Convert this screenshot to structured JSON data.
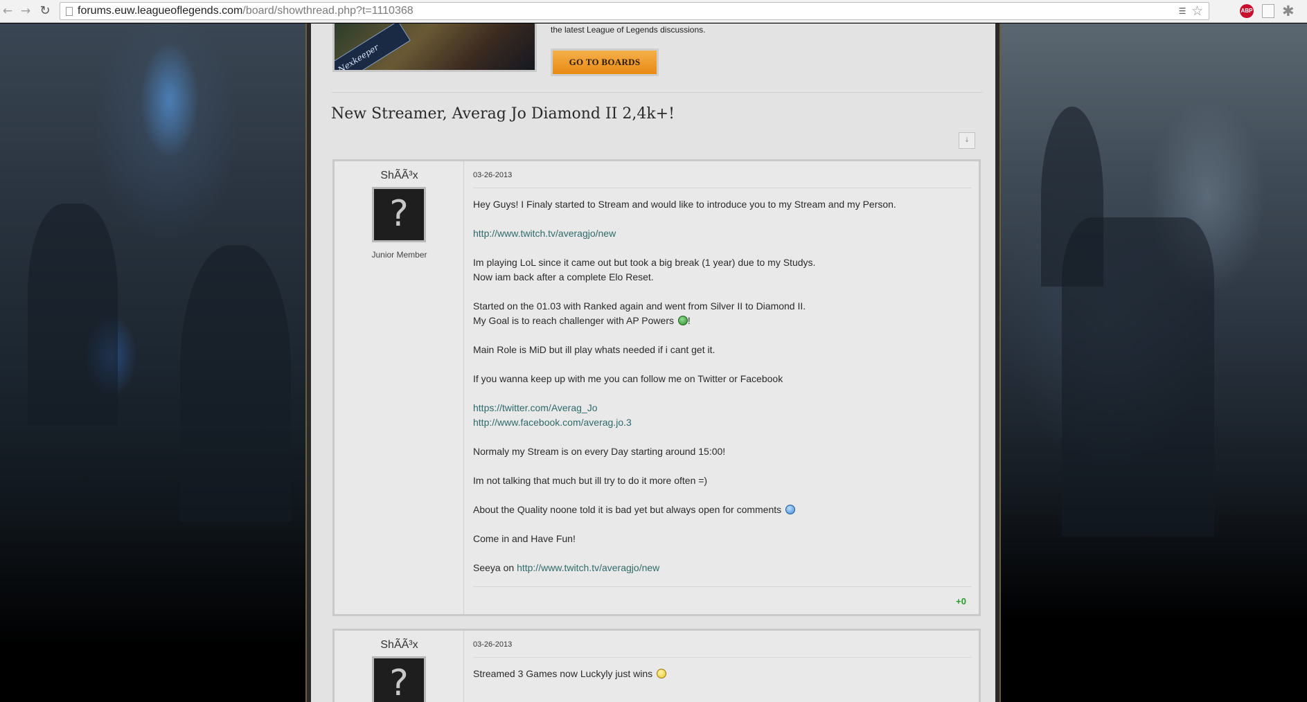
{
  "browser": {
    "url_domain": "forums.euw.leagueoflegends.com",
    "url_path": "/board/showthread.php?t=1110368",
    "extension_abp": "ABP",
    "icons": [
      "back-icon",
      "forward-icon",
      "reload-icon",
      "page-icon",
      "translate-icon",
      "star-icon",
      "adblock-icon",
      "extension-icon",
      "puzzle-icon"
    ]
  },
  "banner": {
    "image_text": "Nexkeeper",
    "text": "the latest League of Legends discussions.",
    "button_label": "GO TO BOARDS"
  },
  "thread": {
    "title": "New Streamer, Averag Jo Diamond II 2,4k+!",
    "tools_label": "↓"
  },
  "posts": [
    {
      "author": "ShÃÃ³x",
      "avatar": "?",
      "rank": "Junior Member",
      "date": "03-26-2013",
      "lines": {
        "l1": "Hey Guys! I Finaly started to Stream and would like to introduce you to my Stream and my Person.",
        "link1": "http://www.twitch.tv/averagjo/new",
        "l2a": "Im playing LoL since it came out but took a big break (1 year) due to my Studys.",
        "l2b": "Now iam back after a complete Elo Reset.",
        "l3a": "Started on the 01.03 with Ranked again and went from Silver II to Diamond II.",
        "l3b": "My Goal is to reach challenger with AP Powers",
        "l3b_end": "!",
        "l4": "Main Role is MiD but ill play whats needed if i cant get it.",
        "l5": "If you wanna keep up with me you can follow me on Twitter or Facebook",
        "link2": "https://twitter.com/Averag_Jo",
        "link3": "http://www.facebook.com/averag.jo.3",
        "l6": "Normaly my Stream is on every Day starting around 15:00!",
        "l7": "Im not talking that much but ill try to do it more often =)",
        "l8": "About the Quality noone told it is bad yet but always open for comments",
        "l9": "Come in and Have Fun!",
        "l10": "Seeya on",
        "link4": "http://www.twitch.tv/averagjo/new"
      },
      "votes": "+0"
    },
    {
      "author": "ShÃÃ³x",
      "avatar": "?",
      "date": "03-26-2013",
      "text": "Streamed 3 Games now Luckyly just wins"
    }
  ],
  "colors": {
    "accent_button": "#e88a14",
    "link": "#2f6a6a",
    "vote_positive": "#2a9a2a",
    "content_bg": "#e3e3e3"
  }
}
